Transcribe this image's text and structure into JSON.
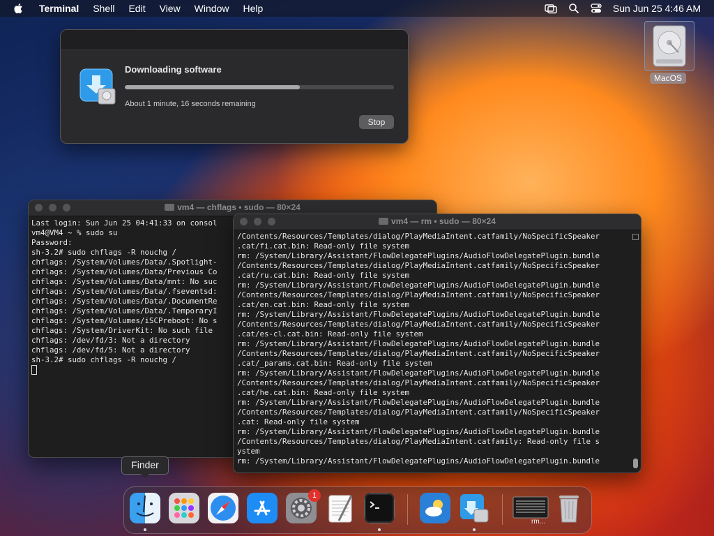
{
  "menubar": {
    "app_name": "Terminal",
    "items": [
      "Shell",
      "Edit",
      "View",
      "Window",
      "Help"
    ],
    "clock": "Sun Jun 25  4:46 AM"
  },
  "desktop": {
    "disk_label": "MacOS"
  },
  "download_dialog": {
    "title": "Downloading software",
    "progress_percent": 65,
    "remaining": "About 1 minute, 16 seconds remaining",
    "stop_label": "Stop"
  },
  "terminal_back": {
    "title": "vm4 — chflags • sudo — 80×24",
    "lines": [
      "Last login: Sun Jun 25 04:41:33 on consol",
      "vm4@VM4 ~ % sudo su",
      "Password:",
      "sh-3.2# sudo chflags -R nouchg /",
      "chflags: /System/Volumes/Data/.Spotlight-",
      "chflags: /System/Volumes/Data/Previous Co",
      "chflags: /System/Volumes/Data/mnt: No suc",
      "chflags: /System/Volumes/Data/.fseventsd:",
      "chflags: /System/Volumes/Data/.DocumentRe",
      "chflags: /System/Volumes/Data/.TemporaryI",
      "chflags: /System/Volumes/iSCPreboot: No s",
      "chflags: /System/DriverKit: No such file",
      "chflags: /dev/fd/3: Not a directory",
      "chflags: /dev/fd/5: Not a directory",
      "sh-3.2# sudo chflags -R nouchg /"
    ]
  },
  "terminal_front": {
    "title": "vm4 — rm • sudo — 80×24",
    "lines": [
      "/Contents/Resources/Templates/dialog/PlayMediaIntent.catfamily/NoSpecificSpeaker",
      ".cat/fi.cat.bin: Read-only file system",
      "rm: /System/Library/Assistant/FlowDelegatePlugins/AudioFlowDelegatePlugin.bundle",
      "/Contents/Resources/Templates/dialog/PlayMediaIntent.catfamily/NoSpecificSpeaker",
      ".cat/ru.cat.bin: Read-only file system",
      "rm: /System/Library/Assistant/FlowDelegatePlugins/AudioFlowDelegatePlugin.bundle",
      "/Contents/Resources/Templates/dialog/PlayMediaIntent.catfamily/NoSpecificSpeaker",
      ".cat/en.cat.bin: Read-only file system",
      "rm: /System/Library/Assistant/FlowDelegatePlugins/AudioFlowDelegatePlugin.bundle",
      "/Contents/Resources/Templates/dialog/PlayMediaIntent.catfamily/NoSpecificSpeaker",
      ".cat/es-cl.cat.bin: Read-only file system",
      "rm: /System/Library/Assistant/FlowDelegatePlugins/AudioFlowDelegatePlugin.bundle",
      "/Contents/Resources/Templates/dialog/PlayMediaIntent.catfamily/NoSpecificSpeaker",
      ".cat/_params.cat.bin: Read-only file system",
      "rm: /System/Library/Assistant/FlowDelegatePlugins/AudioFlowDelegatePlugin.bundle",
      "/Contents/Resources/Templates/dialog/PlayMediaIntent.catfamily/NoSpecificSpeaker",
      ".cat/he.cat.bin: Read-only file system",
      "rm: /System/Library/Assistant/FlowDelegatePlugins/AudioFlowDelegatePlugin.bundle",
      "/Contents/Resources/Templates/dialog/PlayMediaIntent.catfamily/NoSpecificSpeaker",
      ".cat: Read-only file system",
      "rm: /System/Library/Assistant/FlowDelegatePlugins/AudioFlowDelegatePlugin.bundle",
      "/Contents/Resources/Templates/dialog/PlayMediaIntent.catfamily: Read-only file s",
      "ystem",
      "rm: /System/Library/Assistant/FlowDelegatePlugins/AudioFlowDelegatePlugin.bundle"
    ]
  },
  "dock": {
    "tooltip": "Finder",
    "system_preferences_badge": "1",
    "minimized_label": "rm...",
    "icons": [
      "finder-icon",
      "launchpad-icon",
      "safari-icon",
      "app-store-icon",
      "system-preferences-icon",
      "textedit-icon",
      "terminal-icon",
      "weather-icon",
      "installer-icon",
      "minimized-terminal-icon",
      "trash-icon"
    ]
  }
}
